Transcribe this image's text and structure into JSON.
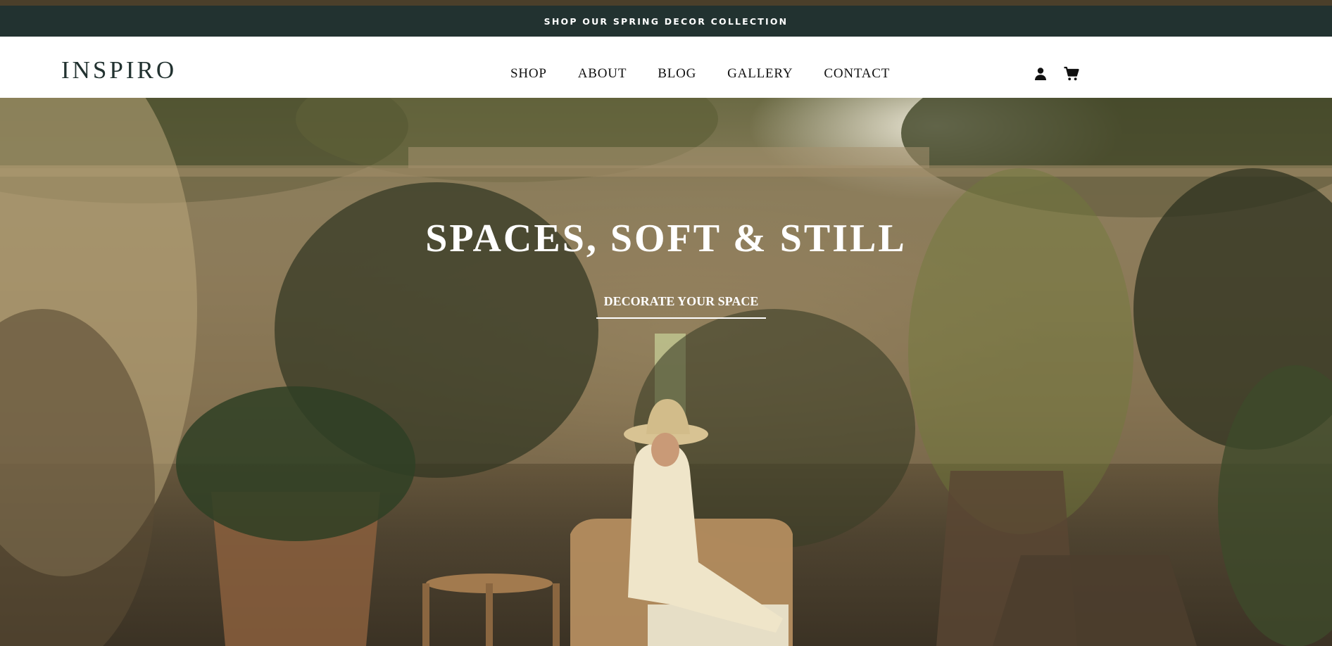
{
  "announcement": {
    "text": "SHOP OUR SPRING DECOR COLLECTION"
  },
  "header": {
    "logo": "INSPIRO",
    "nav": [
      "SHOP",
      "ABOUT",
      "BLOG",
      "GALLERY",
      "CONTACT"
    ],
    "icons": [
      "user-icon",
      "cart-icon"
    ]
  },
  "hero": {
    "title": "SPACES, SOFT & STILL",
    "cta_label": "DECORATE YOUR SPACE"
  },
  "colors": {
    "announcement_bg": "#223230",
    "top_rule": "#4b3f2a",
    "logo": "#223230",
    "nav_text": "#111111"
  }
}
